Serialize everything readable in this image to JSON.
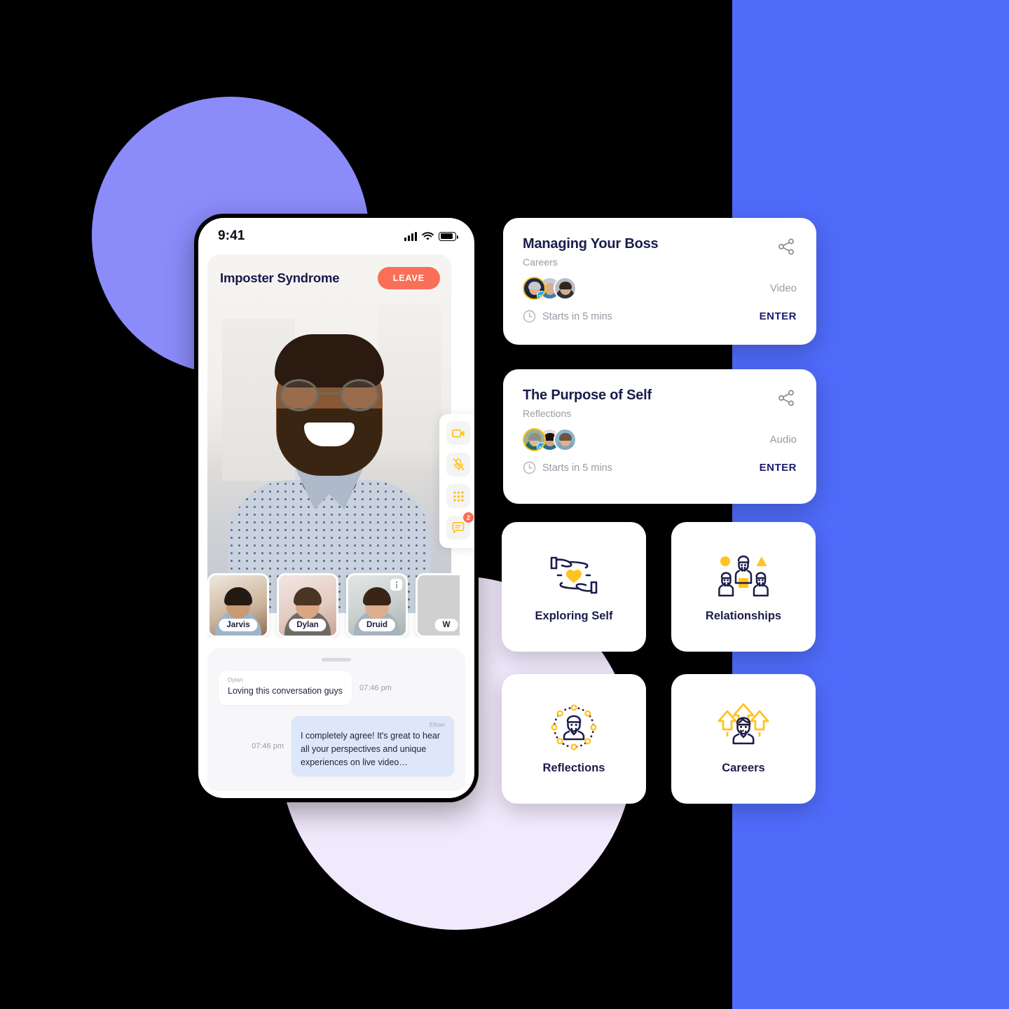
{
  "theme": {
    "background": "#000000",
    "blue_panel": "#4F6BFA",
    "circle_periwinkle": "#8B8BFA",
    "circle_lavender": "#F1E9FC",
    "accent_navy": "#1B1C4B",
    "accent_yellow": "#FFC41F",
    "accent_coral": "#FA6F57",
    "muted_gray": "#9A9AA4"
  },
  "phone": {
    "status_bar": {
      "time": "9:41",
      "signal_icon": "cellular-signal-icon",
      "wifi_icon": "wifi-icon",
      "battery_icon": "battery-icon"
    },
    "call": {
      "title": "Imposter Syndrome",
      "leave_label": "LEAVE",
      "controls": [
        {
          "name": "video-camera-icon",
          "label": "Camera",
          "badge": null
        },
        {
          "name": "microphone-muted-icon",
          "label": "Microphone muted",
          "badge": null
        },
        {
          "name": "grid-dots-icon",
          "label": "Participants grid",
          "badge": null
        },
        {
          "name": "chat-bubble-icon",
          "label": "Chat",
          "badge": "2"
        }
      ],
      "participants": [
        {
          "name": "Jarvis",
          "has_menu": false
        },
        {
          "name": "Dylan",
          "has_menu": false
        },
        {
          "name": "Druid",
          "has_menu": true
        },
        {
          "name": "W",
          "has_menu": false
        }
      ]
    },
    "chat": {
      "messages": [
        {
          "author": "Dylan",
          "text": "Loving this conversation guys",
          "time": "07:46 pm",
          "direction": "in"
        },
        {
          "author": "Ethan",
          "text": "I completely agree! It's great to hear all your perspectives and unique experiences on live video…",
          "time": "07:46 pm",
          "direction": "out"
        }
      ]
    }
  },
  "session_cards": [
    {
      "title": "Managing Your Boss",
      "category": "Careers",
      "media_type": "Video",
      "starts_in": "Starts in 5 mins",
      "enter_label": "ENTER",
      "share_icon": "share-icon",
      "clock_icon": "clock-icon",
      "attendee_count": 3
    },
    {
      "title": "The Purpose of Self",
      "category": "Reflections",
      "media_type": "Audio",
      "starts_in": "Starts in 5 mins",
      "enter_label": "ENTER",
      "share_icon": "share-icon",
      "clock_icon": "clock-icon",
      "attendee_count": 3
    }
  ],
  "category_tiles": [
    {
      "label": "Exploring Self",
      "icon": "hands-holding-heart-icon"
    },
    {
      "label": "Relationships",
      "icon": "group-of-people-icon"
    },
    {
      "label": "Reflections",
      "icon": "person-in-dotted-circle-icon"
    },
    {
      "label": "Careers",
      "icon": "person-with-up-arrows-icon"
    }
  ]
}
